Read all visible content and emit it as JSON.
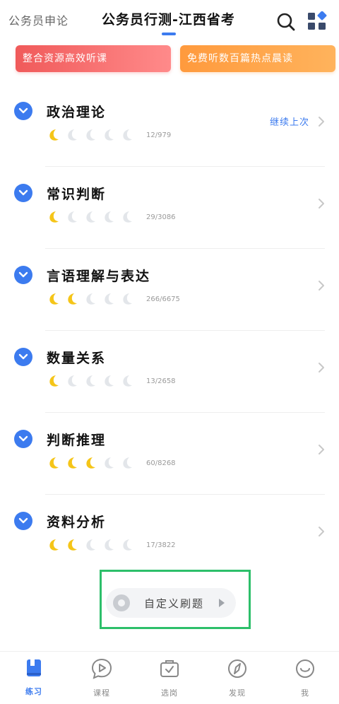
{
  "header": {
    "tab_left": "公务员申论",
    "tab_main": "公务员行测-江西省考"
  },
  "banners": {
    "left": "整合资源高效听课",
    "right": "免费听数百篇热点晨读"
  },
  "sections": [
    {
      "title": "政治理论",
      "count": "12/979",
      "filled": 1,
      "continue": "继续上次"
    },
    {
      "title": "常识判断",
      "count": "29/3086",
      "filled": 1
    },
    {
      "title": "言语理解与表达",
      "count": "266/6675",
      "filled": 2
    },
    {
      "title": "数量关系",
      "count": "13/2658",
      "filled": 1
    },
    {
      "title": "判断推理",
      "count": "60/8268",
      "filled": 3
    },
    {
      "title": "资料分析",
      "count": "17/3822",
      "filled": 2
    }
  ],
  "custom_practice": {
    "label": "自定义刷题"
  },
  "bottom_nav": [
    {
      "label": "练习",
      "icon": "book-icon",
      "active": true
    },
    {
      "label": "课程",
      "icon": "play-bubble-icon",
      "active": false
    },
    {
      "label": "选岗",
      "icon": "briefcase-icon",
      "active": false
    },
    {
      "label": "发现",
      "icon": "compass-icon",
      "active": false
    },
    {
      "label": "我",
      "icon": "smile-icon",
      "active": false
    }
  ],
  "colors": {
    "accent": "#3c7bef",
    "moon_filled": "#f5c518",
    "moon_empty": "#e3e6ea",
    "highlight_frame": "#2dbf6a"
  }
}
